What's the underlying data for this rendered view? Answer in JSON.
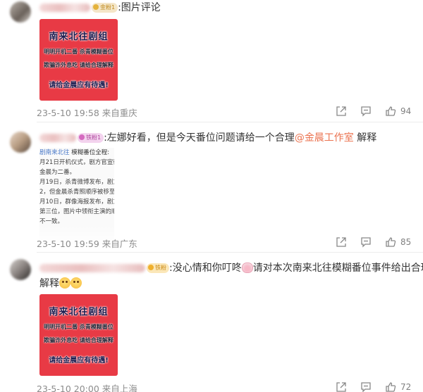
{
  "comments": [
    {
      "badge": "金粉1",
      "text": ":图片评论",
      "poster": {
        "title": "南来北往剧组",
        "line1": "明明开机二番  杀青模糊番位",
        "line2": "欺骗诈外息吃  请给合理解释",
        "line3": "请给金晨应有待遇!"
      },
      "time": "23-5-10 19:58",
      "location": "来自重庆",
      "likes": "94"
    },
    {
      "badge": "铁粉1",
      "text_before": ":左娜好看，但是今天番位问题请给一个合理",
      "mention": "@金晨工作室",
      "text_after": " 解释",
      "doc": {
        "head_blue": "剧南来北往",
        "head_rest": "模糊番位全程:",
        "lines": [
          "月21日开机仪式，剧方官宣微",
          "金晨为二番。",
          "月19日，杀青微博发布，剧方",
          "2，但金晨杀青照顺序被移至第",
          "月10日，群像海报发布，剧方",
          "第三位，图片中领衔主演的顺",
          "不一致。"
        ]
      },
      "time": "23-5-10 19:59",
      "location": "来自广东",
      "likes": "85"
    },
    {
      "badge": "铁粉",
      "text_before": ":没心情和你叮咚",
      "text_after": "请对本次南来北往模糊番位事件给出合理",
      "line2": "解释",
      "poster": {
        "title": "南来北往剧组",
        "line1": "明明开机二番  杀青模糊番位",
        "line2": "欺骗诈外息吃  请给合理解释",
        "line3": "请给金晨应有待遇!"
      },
      "time": "23-5-10 20:00",
      "location": "来自上海",
      "likes": "72"
    }
  ],
  "colors": {
    "mention": "#eb7350",
    "poster_bg": "#e83a45",
    "meta_text": "#8c8c8c"
  },
  "icons": [
    "share-icon",
    "comment-icon",
    "like-icon"
  ]
}
